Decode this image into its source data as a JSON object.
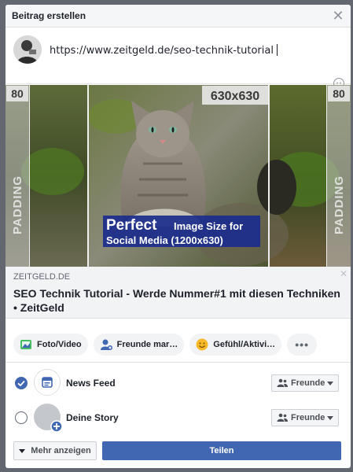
{
  "dialog": {
    "title": "Beitrag erstellen",
    "close_icon": "close-icon"
  },
  "composer": {
    "text": "https://www.zeitgeld.de/seo-technik-tutorial"
  },
  "preview": {
    "image": {
      "left_size": "80",
      "left_padding": "PADDING",
      "center_size": "630x630",
      "right_size": "80",
      "right_padding": "PADDING",
      "banner_perfect": "Perfect",
      "banner_line1": "Image Size for",
      "banner_line2": "Social Media (1200x630)"
    },
    "domain": "ZEITGELD.DE",
    "title": "SEO Technik Tutorial - Werde Nummer#1 mit diesen Techniken • ZeitGeld"
  },
  "actions": [
    {
      "label": "Foto/Video",
      "icon": "photo-icon"
    },
    {
      "label": "Freunde mar…",
      "icon": "tag-friends-icon"
    },
    {
      "label": "Gefühl/Aktivi…",
      "icon": "feeling-icon"
    }
  ],
  "destinations": {
    "news_feed": {
      "label": "News Feed",
      "selected": true,
      "audience": "Freunde"
    },
    "story": {
      "label": "Deine Story",
      "selected": false,
      "audience": "Freunde"
    }
  },
  "footer": {
    "more_label": "Mehr anzeigen",
    "share_label": "Teilen"
  },
  "colors": {
    "primary": "#4267b2",
    "backdrop": "#626770"
  }
}
